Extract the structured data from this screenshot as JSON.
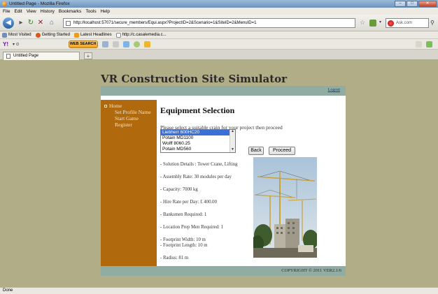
{
  "window": {
    "title": "Untitled Page - Mozilla Firefox"
  },
  "menu": [
    "File",
    "Edit",
    "View",
    "History",
    "Bookmarks",
    "Tools",
    "Help"
  ],
  "nav": {
    "url": "http://localhost:57071/secure_members/Equi.aspx?ProjectID=2&Scenario=1&SiteID=2&MenuID=1",
    "search_placeholder": "Ask.com"
  },
  "bookmarks": [
    {
      "label": "Most Visited",
      "icon": "most-visited-icon"
    },
    {
      "label": "Getting Started",
      "icon": "getting-started-icon"
    },
    {
      "label": "Latest Headlines",
      "icon": "rss-icon"
    },
    {
      "label": "http://c.casalemedia.c...",
      "icon": "page-icon"
    }
  ],
  "toolbar2": {
    "websearch_label": "WEB SEARCH"
  },
  "tab": {
    "label": "Untitled Page"
  },
  "status": "Done",
  "page": {
    "site_title": "VR Construction Site Simulator",
    "logout_label": "Logout",
    "sidebar": {
      "home": "Home",
      "items": [
        "Set Profile Name",
        "Start Game",
        "Register"
      ]
    },
    "heading": "Equipment Selection",
    "intro": "Please select a suitable crain for your project then proceed",
    "crane_options": [
      "Liebherr 600HC20",
      "Potain MD1100",
      "Wolff 8060.25",
      "Potain MD560"
    ],
    "selected_option": "Liebherr 600HC20",
    "back_label": "Back",
    "proceed_label": "Proceed",
    "details": {
      "solution": "- Solution Details : Tower Crane, Lifting",
      "assembly": "- Assembly Rate: 30 modules per day",
      "capacity": "- Capacity: 7000 kg",
      "hire": "- Hire Rate per Day: £ 400.00",
      "banksmen": "- Banksmen Required: 1",
      "prep": "- Location Prep Men Required: 1",
      "footprint_width": "- Footprint Width: 10 m",
      "footprint_length": "- Footprint Length: 10 m",
      "radius": "- Radius: 81 m"
    },
    "copyright": "COPYRIGHT © 2011 VER2.1/6"
  }
}
